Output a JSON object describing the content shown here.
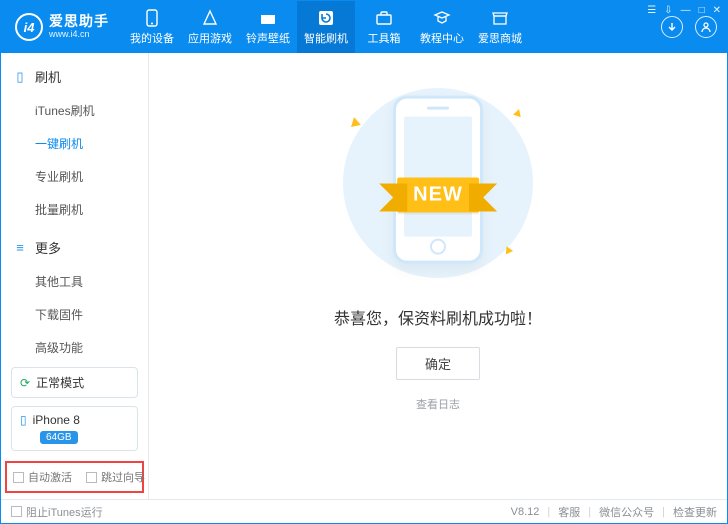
{
  "brand": {
    "initials": "i4",
    "name_cn": "爱思助手",
    "url": "www.i4.cn"
  },
  "nav": {
    "items": [
      {
        "label": "我的设备"
      },
      {
        "label": "应用游戏"
      },
      {
        "label": "铃声壁纸"
      },
      {
        "label": "智能刷机"
      },
      {
        "label": "工具箱"
      },
      {
        "label": "教程中心"
      },
      {
        "label": "爱思商城"
      }
    ],
    "active_index": 3
  },
  "sidebar": {
    "groups": [
      {
        "title": "刷机",
        "items": [
          "iTunes刷机",
          "一键刷机",
          "专业刷机",
          "批量刷机"
        ],
        "active_index": 1
      },
      {
        "title": "更多",
        "items": [
          "其他工具",
          "下载固件",
          "高级功能"
        ],
        "active_index": -1
      }
    ],
    "mode": {
      "label": "正常模式"
    },
    "device": {
      "name": "iPhone 8",
      "storage": "64GB"
    },
    "options": {
      "auto_activate": "自动激活",
      "skip_guide": "跳过向导"
    }
  },
  "main": {
    "banner_text": "NEW",
    "success_msg": "恭喜您，保资料刷机成功啦！",
    "ok_button": "确定",
    "view_log": "查看日志"
  },
  "footer": {
    "block_itunes": "阻止iTunes运行",
    "version": "V8.12",
    "links": [
      "客服",
      "微信公众号",
      "检查更新"
    ]
  }
}
